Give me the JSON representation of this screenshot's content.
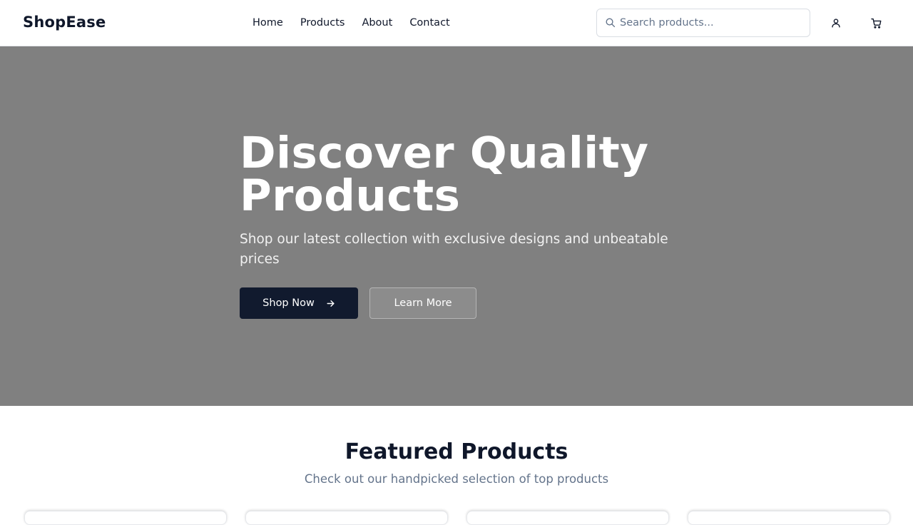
{
  "header": {
    "logo": "ShopEase",
    "nav": [
      "Home",
      "Products",
      "About",
      "Contact"
    ],
    "search": {
      "placeholder": "Search products...",
      "value": ""
    },
    "icons": {
      "search": "search-icon",
      "user": "user-icon",
      "cart": "cart-icon"
    }
  },
  "hero": {
    "title_line1": "Discover Quality",
    "title_line2": "Products",
    "subtitle": "Shop our latest collection with exclusive designs and unbeatable prices",
    "primary_button": "Shop Now",
    "secondary_button": "Learn More",
    "background_color": "#808080",
    "primary_button_color": "#111a2e"
  },
  "featured": {
    "title": "Featured Products",
    "subtitle": "Check out our handpicked selection of top products"
  }
}
